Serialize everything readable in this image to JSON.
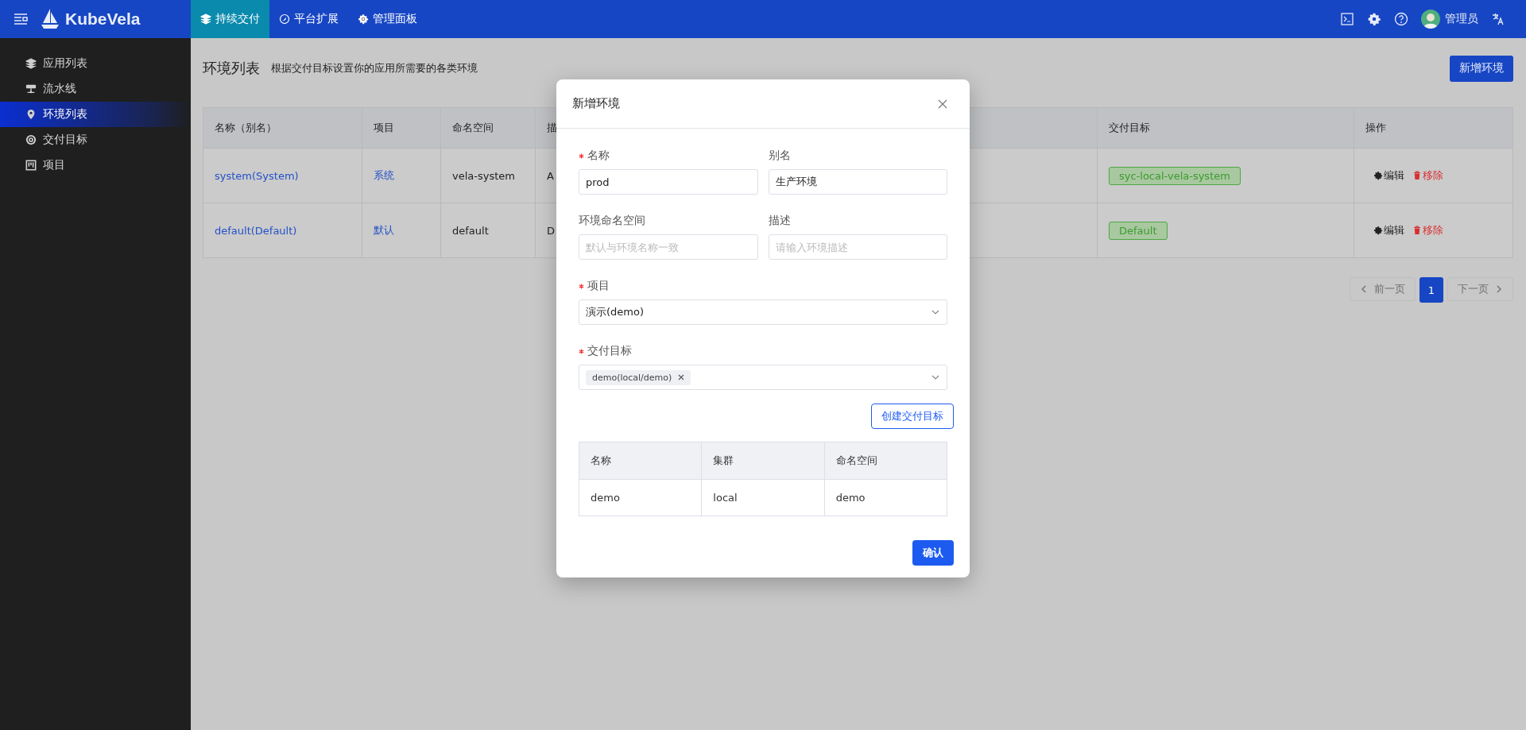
{
  "header": {
    "logo": "KubeVela",
    "nav": [
      {
        "label": "持续交付",
        "selected": true
      },
      {
        "label": "平台扩展",
        "selected": false
      },
      {
        "label": "管理面板",
        "selected": false
      }
    ],
    "user": "管理员"
  },
  "sidebar": {
    "items": [
      {
        "label": "应用列表",
        "selected": false
      },
      {
        "label": "流水线",
        "selected": false
      },
      {
        "label": "环境列表",
        "selected": true
      },
      {
        "label": "交付目标",
        "selected": false
      },
      {
        "label": "项目",
        "selected": false
      }
    ]
  },
  "page": {
    "title": "环境列表",
    "subtitle": "根据交付目标设置你的应用所需要的各类环境",
    "add_button": "新增环境"
  },
  "table": {
    "columns": [
      "名称（别名）",
      "项目",
      "命名空间",
      "描",
      "交付目标",
      "操作"
    ],
    "rows": [
      {
        "name": "system(System)",
        "project": "系统",
        "namespace": "vela-system",
        "description": "A",
        "targets": [
          "syc-local-vela-system"
        ],
        "actions": [
          "编辑",
          "移除"
        ]
      },
      {
        "name": "default(Default)",
        "project": "默认",
        "namespace": "default",
        "description": "D",
        "targets": [
          "Default"
        ],
        "actions": [
          "编辑",
          "移除"
        ]
      }
    ]
  },
  "pagination": {
    "prev": {
      "label": "前一页",
      "disabled": true
    },
    "pages": [
      {
        "label": "1",
        "selected": true
      }
    ],
    "next": {
      "label": "下一页",
      "disabled": true
    }
  },
  "dialog": {
    "title": "新增环境",
    "fields": [
      {
        "kind": "input",
        "label": "名称",
        "required": true,
        "value": "prod"
      },
      {
        "kind": "input",
        "label": "别名",
        "required": false,
        "value": "生产环境"
      },
      {
        "kind": "input",
        "label": "环境命名空间",
        "required": false,
        "placeholder": "默认与环境名称一致"
      },
      {
        "kind": "input",
        "label": "描述",
        "required": false,
        "placeholder": "请输入环境描述"
      },
      {
        "kind": "select",
        "label": "项目",
        "required": true,
        "value": "演示(demo)"
      },
      {
        "kind": "multiselect",
        "label": "交付目标",
        "required": true,
        "tags": [
          "demo(local/demo)"
        ]
      }
    ],
    "create_button": "创建交付目标",
    "target_table": {
      "columns": [
        "名称",
        "集群",
        "命名空间"
      ],
      "rows": [
        [
          "demo",
          "local",
          "demo"
        ]
      ]
    },
    "confirm_button": "确认"
  }
}
